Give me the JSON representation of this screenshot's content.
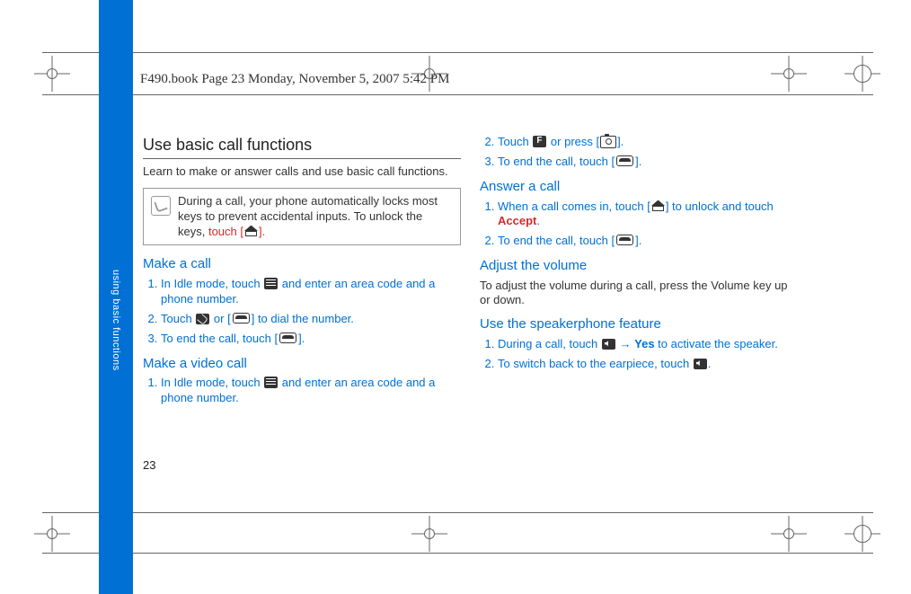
{
  "doc_header": "F490.book  Page 23  Monday, November 5, 2007  5:42 PM",
  "side_tab": "using basic functions",
  "page_number": "23",
  "left": {
    "h1": "Use basic call functions",
    "intro": "Learn to make or answer calls and use basic call functions.",
    "note_pre": "During a call, your phone automatically locks most keys to prevent accidental inputs. To unlock the keys, ",
    "note_link_pre": "touch [",
    "note_link_post": "].",
    "make_call_h": "Make a call",
    "mc1_a": "In Idle mode, touch ",
    "mc1_b": " and enter an area code and a phone number.",
    "mc2_a": "Touch ",
    "mc2_b": " or [",
    "mc2_c": "] to dial the number.",
    "mc3_a": "To end the call, touch [",
    "mc3_b": "].",
    "video_h": "Make a video call",
    "vc1_a": "In Idle mode, touch ",
    "vc1_b": " and enter an area code and a phone number."
  },
  "right": {
    "vc2_a": "Touch ",
    "vc2_b": " or press [",
    "vc2_c": "].",
    "vc3_a": "To end the call, touch [",
    "vc3_b": "].",
    "answer_h": "Answer a call",
    "a1_a": "When a call comes in, touch [",
    "a1_b": "] to unlock and touch ",
    "a1_accept": "Accept",
    "a1_c": ".",
    "a2_a": "To end the call, touch [",
    "a2_b": "].",
    "vol_h": "Adjust the volume",
    "vol_p": "To adjust the volume during a call, press the Volume key up or down.",
    "spk_h": "Use the speakerphone feature",
    "s1_a": "During a call, touch ",
    "s1_arrow": " → ",
    "s1_yes": "Yes",
    "s1_b": " to activate the speaker.",
    "s2_a": "To switch back to the earpiece, touch ",
    "s2_b": "."
  }
}
